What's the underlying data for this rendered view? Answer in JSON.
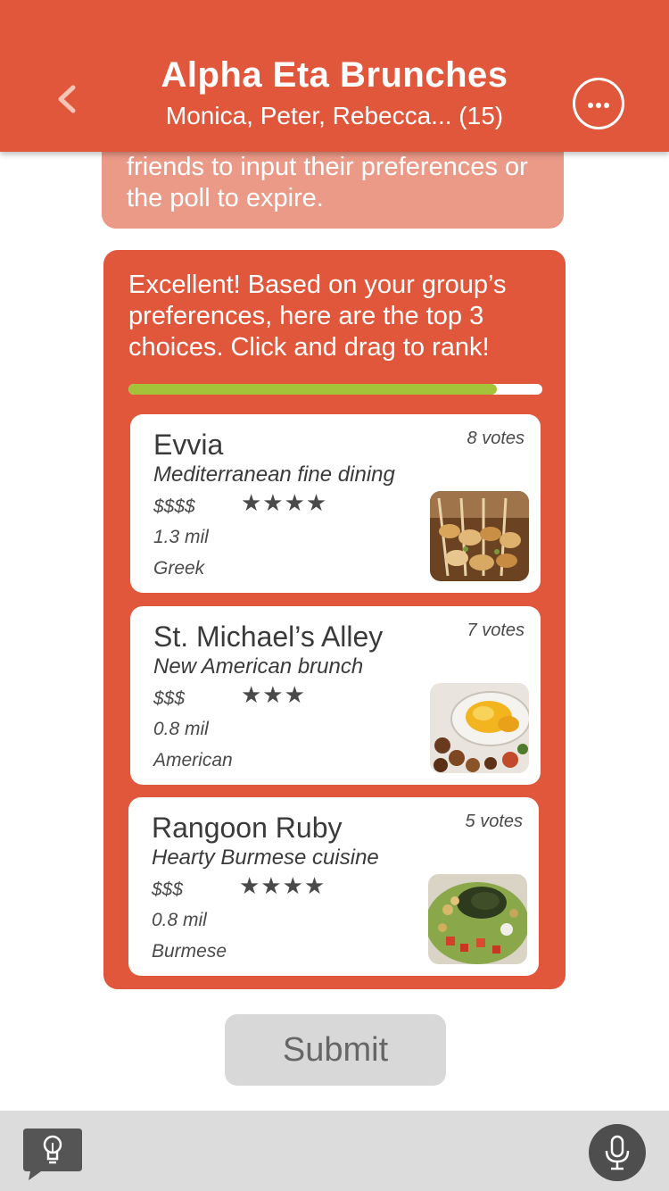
{
  "header": {
    "title": "Alpha Eta Brunches",
    "subtitle": "Monica, Peter, Rebecca... (15)",
    "back_icon": "chevron-left-icon",
    "more_icon": "more-icon",
    "color": "#e0573b"
  },
  "previous_message": {
    "text": "friends to input their preferences or the poll to expire."
  },
  "poll": {
    "message": "Excellent! Based on your group’s preferences, here are the top 3 choices. Click and drag to rank!",
    "progress": 0.89,
    "progress_color": "#a4c23a",
    "choices": [
      {
        "name": "Evvia",
        "votes": "8 votes",
        "description": "Mediterranean fine dining",
        "price": "$$$$",
        "stars": "★★★★",
        "distance": "1.3 mil",
        "cuisine": "Greek"
      },
      {
        "name": "St. Michael’s Alley",
        "votes": "7 votes",
        "description": "New American brunch",
        "price": "$$$",
        "stars": "★★★",
        "distance": "0.8 mil",
        "cuisine": "American"
      },
      {
        "name": "Rangoon Ruby",
        "votes": "5 votes",
        "description": "Hearty Burmese cuisine",
        "price": "$$$",
        "stars": "★★★★",
        "distance": "0.8 mil",
        "cuisine": "Burmese"
      }
    ]
  },
  "submit": {
    "label": "Submit"
  },
  "bottom_bar": {
    "idea_icon": "lightbulb-icon",
    "mic_icon": "microphone-icon"
  }
}
